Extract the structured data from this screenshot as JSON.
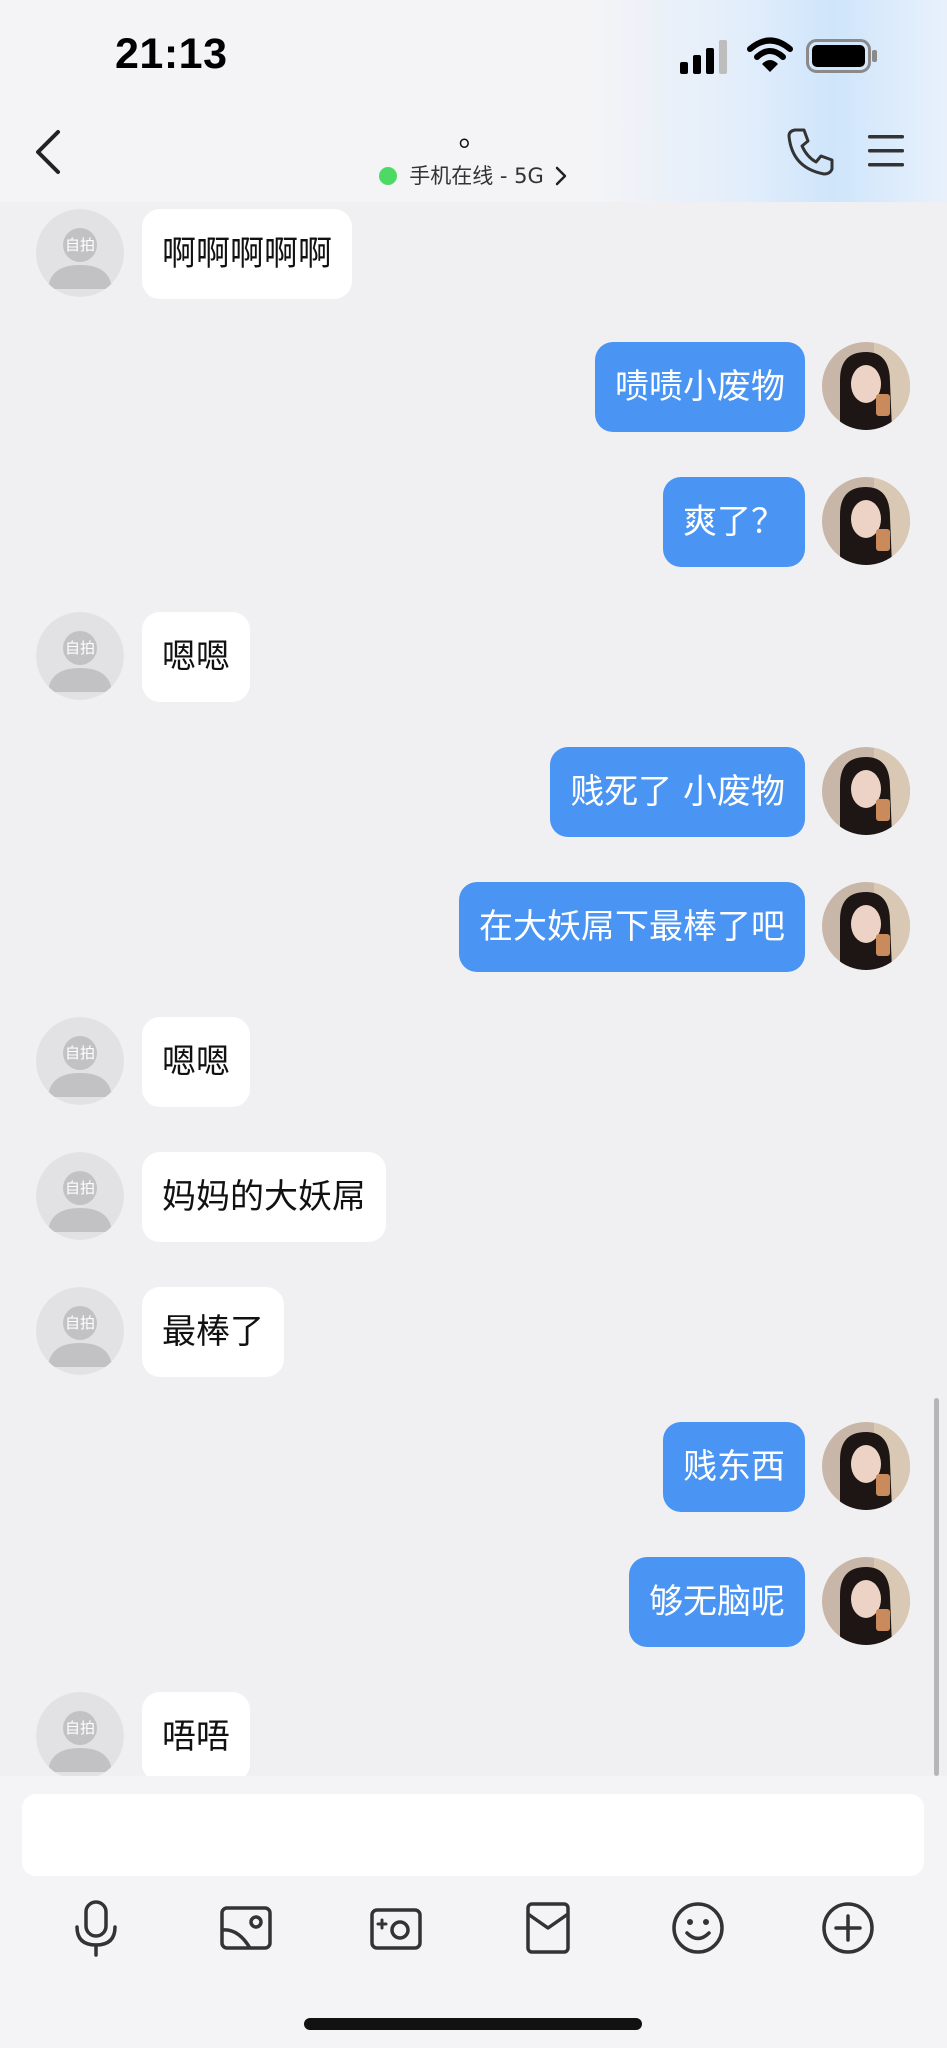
{
  "status_bar": {
    "time": "21:13"
  },
  "header": {
    "title": "。",
    "status_text": "手机在线 - 5G"
  },
  "messages": [
    {
      "direction": "in",
      "text": "啊啊啊啊啊"
    },
    {
      "direction": "out",
      "text": "啧啧小废物"
    },
    {
      "direction": "out",
      "text": "爽了？"
    },
    {
      "direction": "in",
      "text": "嗯嗯"
    },
    {
      "direction": "out",
      "text": "贱死了 小废物"
    },
    {
      "direction": "out",
      "text": "在大妖屌下最棒了吧"
    },
    {
      "direction": "in",
      "text": "嗯嗯"
    },
    {
      "direction": "in",
      "text": "妈妈的大妖屌"
    },
    {
      "direction": "in",
      "text": "最棒了"
    },
    {
      "direction": "out",
      "text": "贱东西"
    },
    {
      "direction": "out",
      "text": "够无脑呢"
    },
    {
      "direction": "in",
      "text": "唔唔"
    }
  ],
  "placeholder_avatar_text": "自拍",
  "composer": {
    "value": "",
    "tools": [
      "microphone-icon",
      "image-icon",
      "camera-icon",
      "red-packet-icon",
      "emoji-icon",
      "plus-icon"
    ]
  },
  "colors": {
    "outgoing_bubble": "#4a94f3",
    "incoming_bubble": "#ffffff",
    "background": "#f0f0f2",
    "online_dot": "#4cd964"
  }
}
